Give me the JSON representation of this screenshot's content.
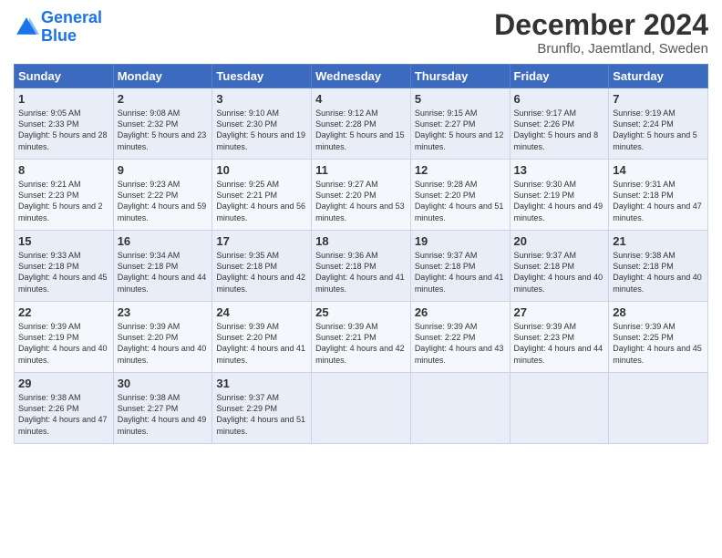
{
  "logo": {
    "line1": "General",
    "line2": "Blue"
  },
  "title": "December 2024",
  "subtitle": "Brunflo, Jaemtland, Sweden",
  "days_of_week": [
    "Sunday",
    "Monday",
    "Tuesday",
    "Wednesday",
    "Thursday",
    "Friday",
    "Saturday"
  ],
  "weeks": [
    [
      {
        "day": "1",
        "sunrise": "9:05 AM",
        "sunset": "2:33 PM",
        "daylight": "5 hours and 28 minutes."
      },
      {
        "day": "2",
        "sunrise": "9:08 AM",
        "sunset": "2:32 PM",
        "daylight": "5 hours and 23 minutes."
      },
      {
        "day": "3",
        "sunrise": "9:10 AM",
        "sunset": "2:30 PM",
        "daylight": "5 hours and 19 minutes."
      },
      {
        "day": "4",
        "sunrise": "9:12 AM",
        "sunset": "2:28 PM",
        "daylight": "5 hours and 15 minutes."
      },
      {
        "day": "5",
        "sunrise": "9:15 AM",
        "sunset": "2:27 PM",
        "daylight": "5 hours and 12 minutes."
      },
      {
        "day": "6",
        "sunrise": "9:17 AM",
        "sunset": "2:26 PM",
        "daylight": "5 hours and 8 minutes."
      },
      {
        "day": "7",
        "sunrise": "9:19 AM",
        "sunset": "2:24 PM",
        "daylight": "5 hours and 5 minutes."
      }
    ],
    [
      {
        "day": "8",
        "sunrise": "9:21 AM",
        "sunset": "2:23 PM",
        "daylight": "5 hours and 2 minutes."
      },
      {
        "day": "9",
        "sunrise": "9:23 AM",
        "sunset": "2:22 PM",
        "daylight": "4 hours and 59 minutes."
      },
      {
        "day": "10",
        "sunrise": "9:25 AM",
        "sunset": "2:21 PM",
        "daylight": "4 hours and 56 minutes."
      },
      {
        "day": "11",
        "sunrise": "9:27 AM",
        "sunset": "2:20 PM",
        "daylight": "4 hours and 53 minutes."
      },
      {
        "day": "12",
        "sunrise": "9:28 AM",
        "sunset": "2:20 PM",
        "daylight": "4 hours and 51 minutes."
      },
      {
        "day": "13",
        "sunrise": "9:30 AM",
        "sunset": "2:19 PM",
        "daylight": "4 hours and 49 minutes."
      },
      {
        "day": "14",
        "sunrise": "9:31 AM",
        "sunset": "2:18 PM",
        "daylight": "4 hours and 47 minutes."
      }
    ],
    [
      {
        "day": "15",
        "sunrise": "9:33 AM",
        "sunset": "2:18 PM",
        "daylight": "4 hours and 45 minutes."
      },
      {
        "day": "16",
        "sunrise": "9:34 AM",
        "sunset": "2:18 PM",
        "daylight": "4 hours and 44 minutes."
      },
      {
        "day": "17",
        "sunrise": "9:35 AM",
        "sunset": "2:18 PM",
        "daylight": "4 hours and 42 minutes."
      },
      {
        "day": "18",
        "sunrise": "9:36 AM",
        "sunset": "2:18 PM",
        "daylight": "4 hours and 41 minutes."
      },
      {
        "day": "19",
        "sunrise": "9:37 AM",
        "sunset": "2:18 PM",
        "daylight": "4 hours and 41 minutes."
      },
      {
        "day": "20",
        "sunrise": "9:37 AM",
        "sunset": "2:18 PM",
        "daylight": "4 hours and 40 minutes."
      },
      {
        "day": "21",
        "sunrise": "9:38 AM",
        "sunset": "2:18 PM",
        "daylight": "4 hours and 40 minutes."
      }
    ],
    [
      {
        "day": "22",
        "sunrise": "9:39 AM",
        "sunset": "2:19 PM",
        "daylight": "4 hours and 40 minutes."
      },
      {
        "day": "23",
        "sunrise": "9:39 AM",
        "sunset": "2:20 PM",
        "daylight": "4 hours and 40 minutes."
      },
      {
        "day": "24",
        "sunrise": "9:39 AM",
        "sunset": "2:20 PM",
        "daylight": "4 hours and 41 minutes."
      },
      {
        "day": "25",
        "sunrise": "9:39 AM",
        "sunset": "2:21 PM",
        "daylight": "4 hours and 42 minutes."
      },
      {
        "day": "26",
        "sunrise": "9:39 AM",
        "sunset": "2:22 PM",
        "daylight": "4 hours and 43 minutes."
      },
      {
        "day": "27",
        "sunrise": "9:39 AM",
        "sunset": "2:23 PM",
        "daylight": "4 hours and 44 minutes."
      },
      {
        "day": "28",
        "sunrise": "9:39 AM",
        "sunset": "2:25 PM",
        "daylight": "4 hours and 45 minutes."
      }
    ],
    [
      {
        "day": "29",
        "sunrise": "9:38 AM",
        "sunset": "2:26 PM",
        "daylight": "4 hours and 47 minutes."
      },
      {
        "day": "30",
        "sunrise": "9:38 AM",
        "sunset": "2:27 PM",
        "daylight": "4 hours and 49 minutes."
      },
      {
        "day": "31",
        "sunrise": "9:37 AM",
        "sunset": "2:29 PM",
        "daylight": "4 hours and 51 minutes."
      },
      null,
      null,
      null,
      null
    ]
  ]
}
